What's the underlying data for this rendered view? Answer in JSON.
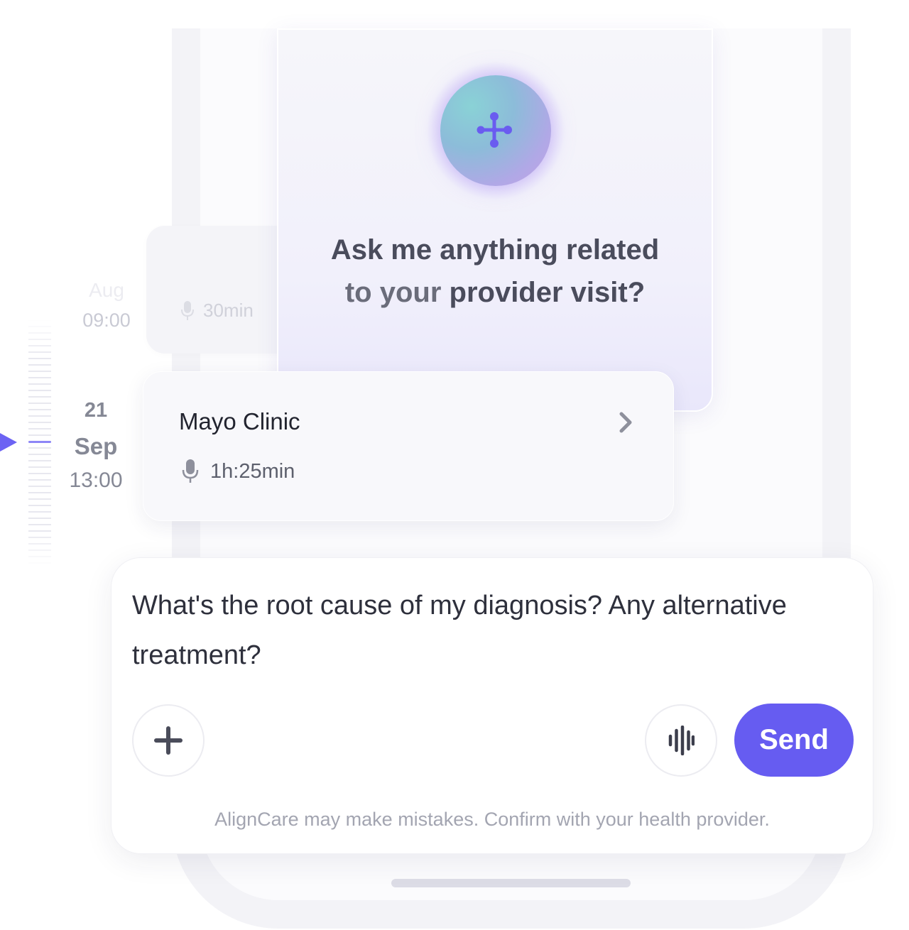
{
  "ai_assistant": {
    "prompt_line1": "Ask me anything related",
    "prompt_line2_part1": "to your ",
    "prompt_line2_part2": "provider visit?",
    "orb_icon": "care-network-icon"
  },
  "timeline": {
    "previous_entry": {
      "month": "Aug",
      "time": "09:00",
      "duration": "30min",
      "duration_icon": "microphone-icon"
    },
    "current_entry": {
      "day": "21",
      "month": "Sep",
      "time": "13:00",
      "provider": "Mayo Clinic",
      "duration": "1h:25min",
      "duration_icon": "microphone-icon",
      "open_icon": "chevron-right-icon"
    }
  },
  "composer": {
    "message": "What's the root cause of my diagnosis? Any alternative treatment?",
    "attach_icon": "plus-icon",
    "voice_icon": "voice-waveform-icon",
    "send_label": "Send",
    "disclaimer": "AlignCare may make mistakes. Confirm with your health provider."
  },
  "colors": {
    "accent": "#665cf1",
    "pointer": "#6c63f3",
    "text_primary": "#22242f",
    "text_muted": "#858895"
  }
}
